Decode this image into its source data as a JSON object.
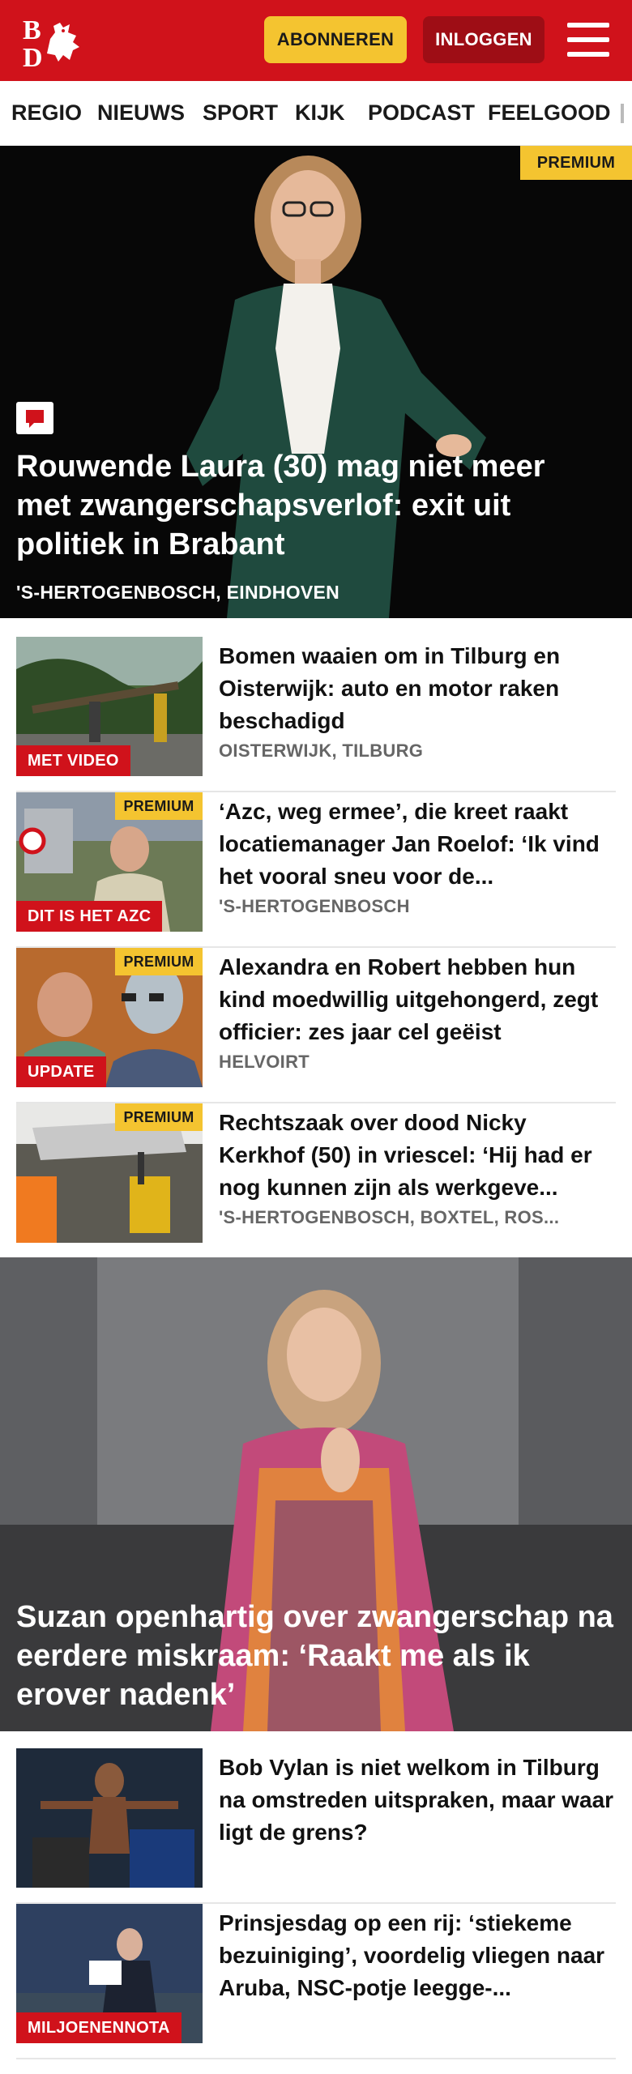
{
  "header": {
    "logo_text": "BD",
    "subscribe_label": "ABONNEREN",
    "login_label": "INLOGGEN"
  },
  "nav": {
    "items": [
      "REGIO",
      "NIEUWS",
      "SPORT",
      "KIJK",
      "PODCAST",
      "FEELGOOD"
    ]
  },
  "hero": {
    "badge": "PREMIUM",
    "title": "Rouwende Laura (30) mag niet meer met zwangerschapsverlof: exit uit politiek in Brabant",
    "location": "'S-HERTOGENBOSCH, EINDHOVEN"
  },
  "articles": [
    {
      "title": "Bomen waaien om in Tilburg en Oisterwijk: auto en motor raken beschadigd",
      "location": "OISTERWIJK, TILBURG",
      "label": "MET VIDEO",
      "premium": ""
    },
    {
      "title": "‘Azc, weg ermee’, die kreet raakt locatiemanager Jan Roelof: ‘Ik vind het vooral sneu voor de...",
      "location": "'S-HERTOGENBOSCH",
      "label": "DIT IS HET AZC",
      "premium": "PREMIUM"
    },
    {
      "title": "Alexandra en Robert hebben hun kind moedwillig uitgehongerd, zegt officier: zes jaar cel geëist",
      "location": "HELVOIRT",
      "label": "UPDATE",
      "premium": "PREMIUM"
    },
    {
      "title": "Rechtszaak over dood Nicky Kerkhof (50) in vriescel: ‘Hij had er nog kunnen zijn als werkgeve...",
      "location": "'S-HERTOGENBOSCH, BOXTEL, ROS...",
      "label": "",
      "premium": "PREMIUM"
    }
  ],
  "hero2": {
    "title": "Suzan openhartig over zwangerschap na eerdere miskraam: ‘Raakt me als ik erover nadenk’"
  },
  "articles2": [
    {
      "title": "Bob Vylan is niet welkom in Tilburg na omstreden uitspraken, maar waar ligt de grens?",
      "label": ""
    },
    {
      "title": "Prinsjesdag op een rij: ‘stiekeme bezuiniging’, voordelig vliegen naar Aruba, NSC-potje leegge-...",
      "label": "MILJOENENNOTA"
    }
  ],
  "colors": {
    "brand_red": "#d0121b",
    "premium_yellow": "#f4c430",
    "login_dark_red": "#9e0d15"
  }
}
